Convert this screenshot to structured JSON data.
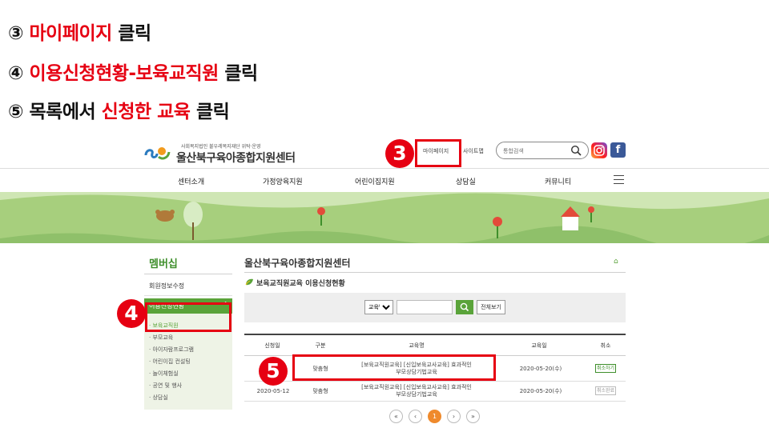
{
  "instructions": [
    {
      "num": "③",
      "highlight": "마이페이지",
      "suffix": " 클릭"
    },
    {
      "num": "④",
      "highlight": "이용신청현황-보육교직원",
      "suffix": " 클릭"
    },
    {
      "num": "⑤",
      "prefix": "목록에서 ",
      "highlight": "신청한 교육",
      "suffix": " 클릭"
    }
  ],
  "header": {
    "logo_sub": "사회복지법인 불우레복지재단 위탁·운영",
    "logo_name": "울산북구육아종합지원센터",
    "mypage": "마이페이지",
    "sitemap": "사이트맵",
    "search_placeholder": "통합검색",
    "facebook": "f"
  },
  "nav": [
    "센터소개",
    "가정양육지원",
    "어린이집지원",
    "상담실",
    "커뮤니티"
  ],
  "sidebar": {
    "title": "멤버십",
    "profile": "회원정보수정",
    "active": "이용신청현황",
    "active_chevron": "^",
    "sub_items": [
      "보육교직원",
      "부모교육",
      "아이자람프로그램",
      "어린이집 컨설팅",
      "놀이체험실",
      "공연 및 행사",
      "상담실"
    ]
  },
  "main": {
    "title": "울산북구육아종합지원센터",
    "subtitle": "보육교직원교육 이용신청현황",
    "filter_select": "교육명",
    "filter_all": "전체보기"
  },
  "table": {
    "headers": [
      "신청일",
      "구분",
      "교육명",
      "교육일",
      "취소"
    ],
    "rows": [
      {
        "date": "",
        "type": "맞춤형",
        "name1": "[보육교직원교육] [신입보육교사교육] 효과적인",
        "name2": "부모상담기법교육",
        "edu_date": "2020-05-20(수)",
        "cancel": "취소하기"
      },
      {
        "date": "2020-05-12",
        "type": "맞춤형",
        "name1": "[보육교직원교육] [신입보육교사교육] 효과적인",
        "name2": "부모상담기법교육",
        "edu_date": "2020-05-20(수)",
        "cancel": "취소완료"
      }
    ]
  },
  "pagination": {
    "first": "«",
    "prev": "‹",
    "current": "1",
    "next": "›",
    "last": "»"
  },
  "badges": {
    "b3": "3",
    "b4": "4",
    "b5": "5"
  },
  "colors": {
    "accent_red": "#e60012",
    "green": "#5aa33a",
    "banner": "#a7cf7d",
    "page_orange": "#ef8a2c"
  }
}
